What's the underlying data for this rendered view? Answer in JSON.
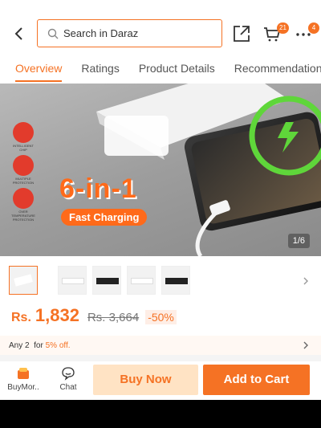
{
  "header": {
    "search_placeholder": "Search in Daraz",
    "cart_badge": "21",
    "more_badge": "4"
  },
  "tabs": [
    {
      "label": "Overview",
      "active": true
    },
    {
      "label": "Ratings"
    },
    {
      "label": "Product Details"
    },
    {
      "label": "Recommendations"
    }
  ],
  "hero": {
    "headline": "6-in-1",
    "subline": "Fast Charging",
    "features": [
      "INTELLIGENT CHIP",
      "MULTIPLE PROTECTION",
      "OVER TEMPERATURE PROTECTION"
    ],
    "counter": "1/6"
  },
  "price": {
    "currency": "Rs.",
    "current": "1,832",
    "original": "Rs. 3,664",
    "discount": "-50%"
  },
  "promo": {
    "prefix": "Any 2",
    "mid": "for",
    "offer": "5% off."
  },
  "bottom": {
    "store_label": "BuyMor..",
    "chat_label": "Chat",
    "buy_now": "Buy Now",
    "add_to_cart": "Add to Cart"
  },
  "colors": {
    "accent": "#f57224",
    "accent_light": "#ffe3c4"
  }
}
